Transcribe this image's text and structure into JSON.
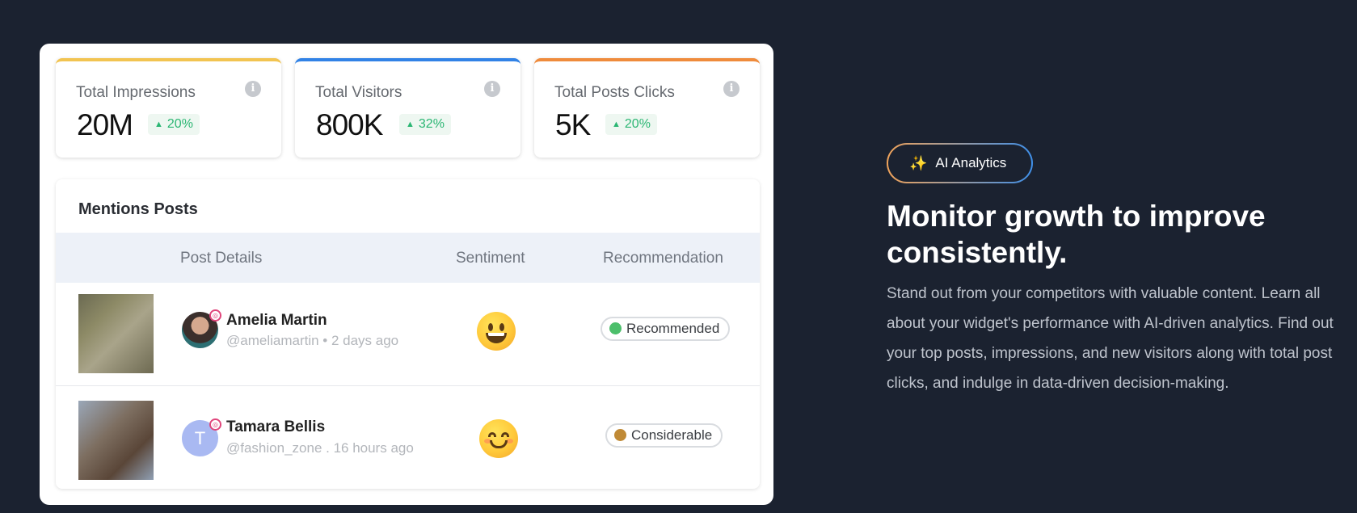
{
  "stats": [
    {
      "title": "Total Impressions",
      "value": "20M",
      "change": "20%",
      "accent": "#f2c451"
    },
    {
      "title": "Total Visitors",
      "value": "800K",
      "change": "32%",
      "accent": "#3182e6"
    },
    {
      "title": "Total Posts Clicks",
      "value": "5K",
      "change": "20%",
      "accent": "#ef8b3c"
    }
  ],
  "mentions": {
    "title": "Mentions Posts",
    "columns": [
      "Post Details",
      "Sentiment",
      "Recommendation"
    ],
    "rows": [
      {
        "name": "Amelia Martin",
        "meta": "@ameliamartin • 2 days ago",
        "sentiment_icon": "grinning-face-icon",
        "recommendation": "Recommended",
        "rec_color": "#4cbf6b",
        "avatar_letter": ""
      },
      {
        "name": "Tamara Bellis",
        "meta": "@fashion_zone . 16 hours ago",
        "sentiment_icon": "smiling-face-icon",
        "recommendation": "Considerable",
        "rec_color": "#c08a36",
        "avatar_letter": "T"
      }
    ]
  },
  "badge": {
    "label": "AI Analytics",
    "icon": "magic-wand-icon"
  },
  "headline": "Monitor growth to improve consistently.",
  "description": "Stand out from your competitors with valuable content. Learn all about your widget's performance with AI-driven analytics. Find out your top posts, impressions, and new visitors along with total post clicks, and indulge in data-driven decision-making.",
  "colors": {
    "background": "#1b2230",
    "positive": "#2bb673"
  }
}
